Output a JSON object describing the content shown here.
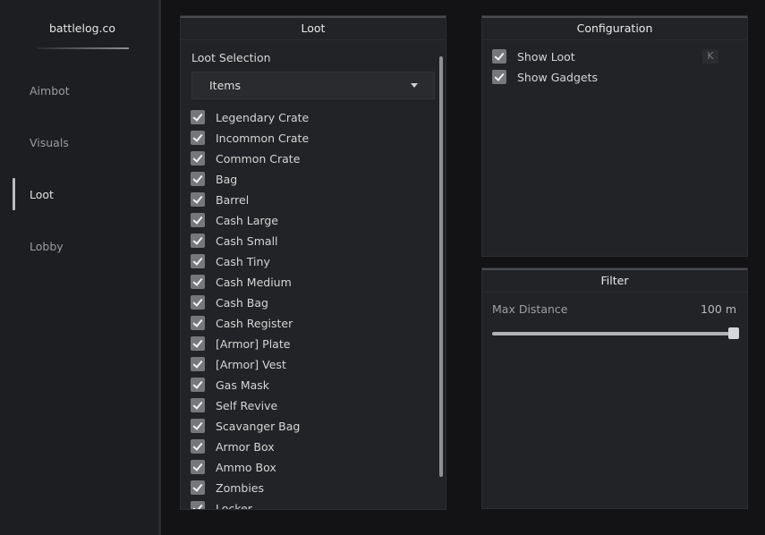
{
  "sidebar": {
    "brand": "battlelog.co",
    "items": [
      {
        "label": "Aimbot",
        "active": false
      },
      {
        "label": "Visuals",
        "active": false
      },
      {
        "label": "Loot",
        "active": true
      },
      {
        "label": "Lobby",
        "active": false
      }
    ]
  },
  "loot": {
    "title": "Loot",
    "selection_label": "Loot Selection",
    "dropdown_value": "Items",
    "items": [
      {
        "label": "Legendary Crate",
        "checked": true
      },
      {
        "label": "Incommon Crate",
        "checked": true
      },
      {
        "label": "Common Crate",
        "checked": true
      },
      {
        "label": "Bag",
        "checked": true
      },
      {
        "label": "Barrel",
        "checked": true
      },
      {
        "label": "Cash Large",
        "checked": true
      },
      {
        "label": "Cash Small",
        "checked": true
      },
      {
        "label": "Cash Tiny",
        "checked": true
      },
      {
        "label": "Cash Medium",
        "checked": true
      },
      {
        "label": "Cash Bag",
        "checked": true
      },
      {
        "label": "Cash Register",
        "checked": true
      },
      {
        "label": "[Armor] Plate",
        "checked": true
      },
      {
        "label": "[Armor] Vest",
        "checked": true
      },
      {
        "label": "Gas Mask",
        "checked": true
      },
      {
        "label": "Self Revive",
        "checked": true
      },
      {
        "label": "Scavanger Bag",
        "checked": true
      },
      {
        "label": "Armor Box",
        "checked": true
      },
      {
        "label": "Ammo Box",
        "checked": true
      },
      {
        "label": "Zombies",
        "checked": true
      },
      {
        "label": "Locker",
        "checked": true
      }
    ]
  },
  "configuration": {
    "title": "Configuration",
    "items": [
      {
        "label": "Show Loot",
        "checked": true
      },
      {
        "label": "Show Gadgets",
        "checked": true
      }
    ],
    "keybind": "K"
  },
  "filter": {
    "title": "Filter",
    "max_distance_label": "Max Distance",
    "max_distance_value": "100 m",
    "max_distance_fraction": 1.0
  }
}
